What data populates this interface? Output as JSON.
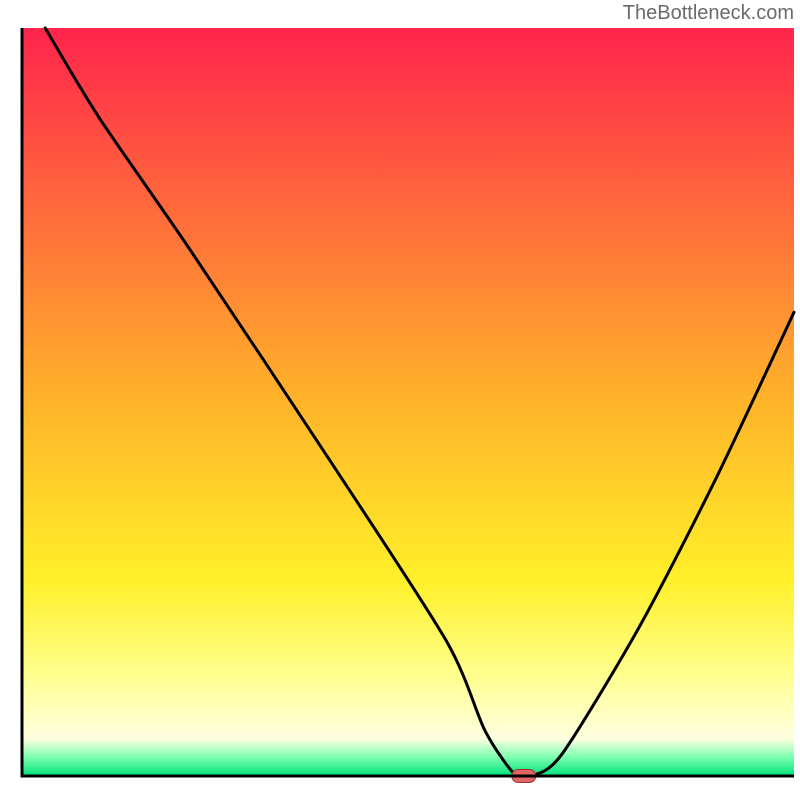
{
  "watermark": "TheBottleneck.com",
  "chart_data": {
    "type": "line",
    "title": "",
    "xlabel": "",
    "ylabel": "",
    "xlim": [
      0,
      100
    ],
    "ylim": [
      0,
      100
    ],
    "series": [
      {
        "name": "curve",
        "x": [
          3,
          10,
          22,
          40,
          55,
          60,
          64,
          66,
          70,
          80,
          90,
          100
        ],
        "y": [
          100,
          88,
          70,
          42,
          18,
          6,
          0,
          0,
          3,
          20,
          40,
          62
        ]
      }
    ],
    "marker": {
      "x": 65,
      "y": 0
    },
    "gradient_stops": [
      {
        "offset": 0.0,
        "color": "#ff244c"
      },
      {
        "offset": 0.5,
        "color": "#ffb42a"
      },
      {
        "offset": 0.74,
        "color": "#fff02a"
      },
      {
        "offset": 0.86,
        "color": "#ffff8a"
      },
      {
        "offset": 0.95,
        "color": "#ffffe0"
      },
      {
        "offset": 0.975,
        "color": "#7bffb0"
      },
      {
        "offset": 1.0,
        "color": "#00e07a"
      }
    ],
    "colors": {
      "marker_fill": "#e06666",
      "marker_stroke": "#a03030",
      "curve_stroke": "#000000",
      "frame_stroke": "#000000"
    }
  }
}
